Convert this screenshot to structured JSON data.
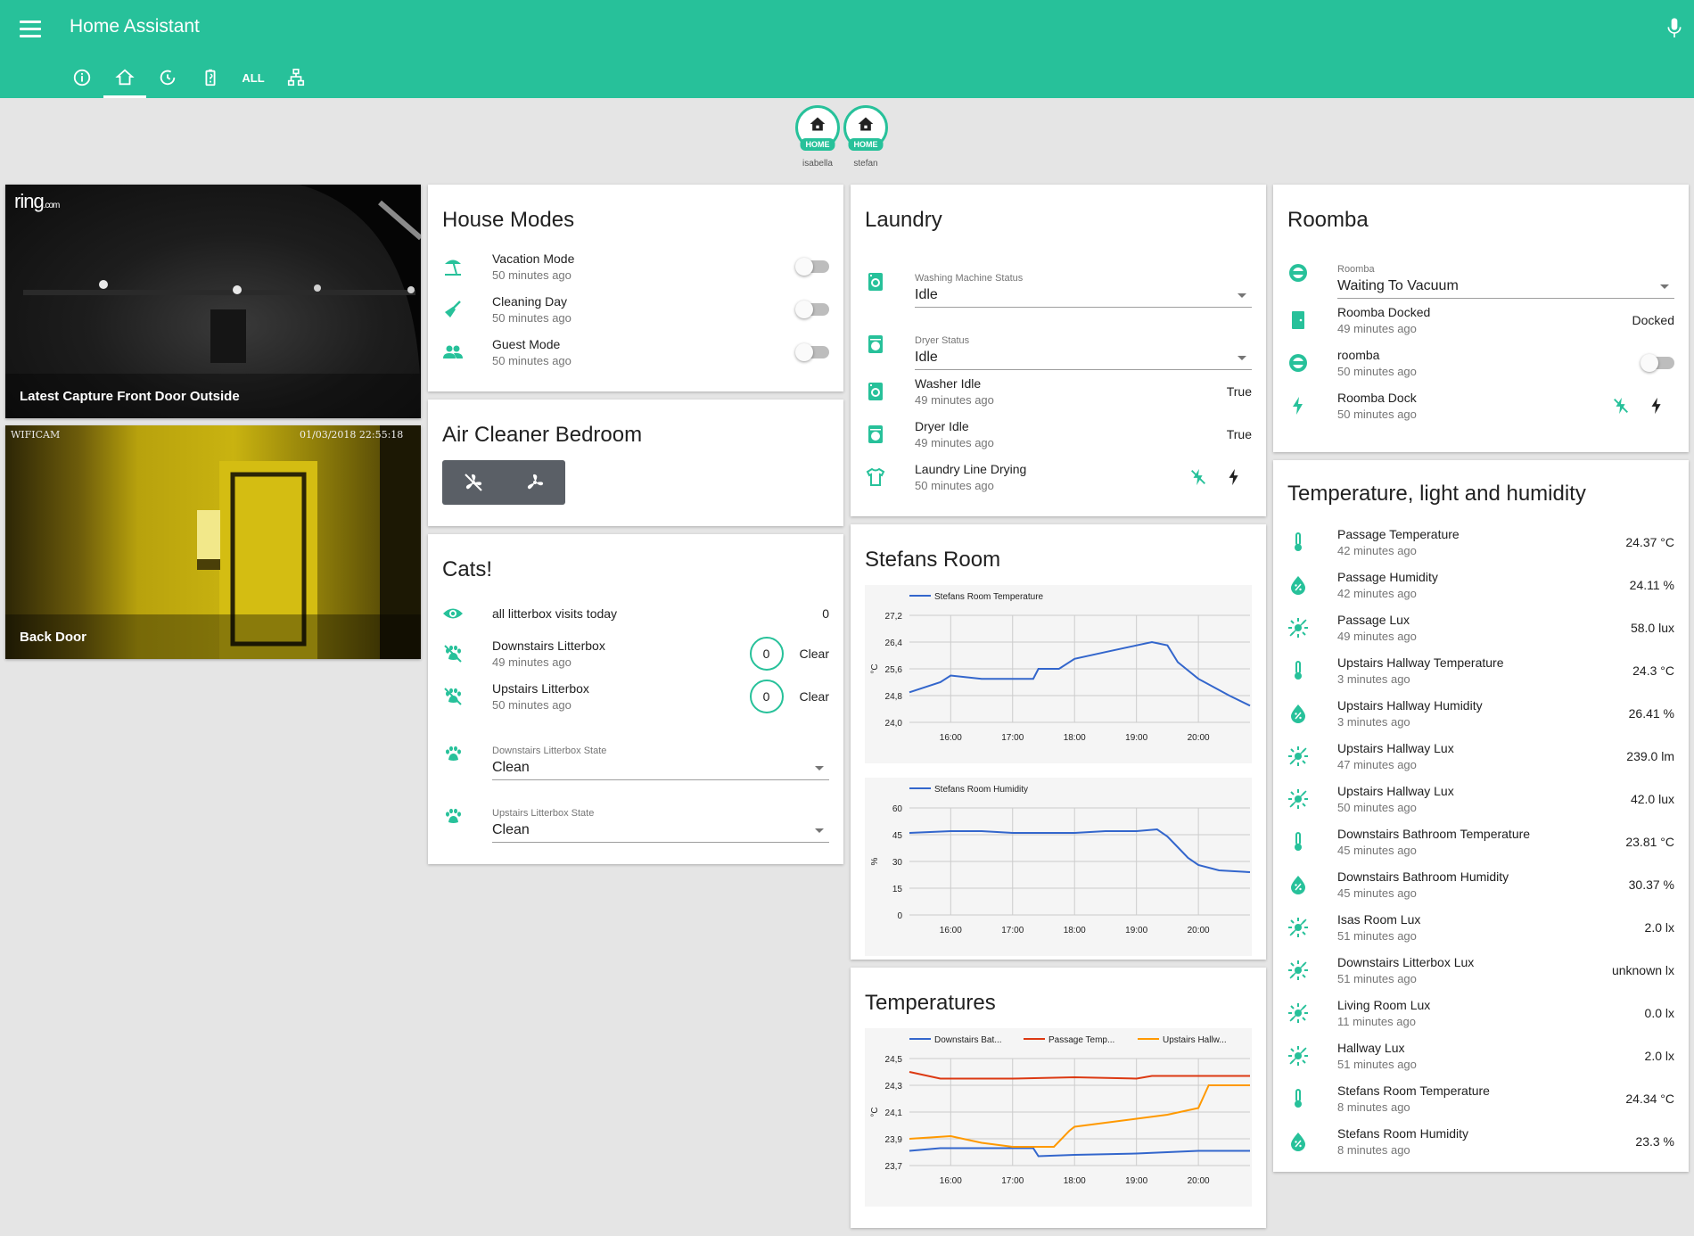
{
  "header": {
    "title": "Home Assistant",
    "tabs": [
      {
        "icon": "info-icon"
      },
      {
        "icon": "home-icon",
        "active": true
      },
      {
        "icon": "history-icon"
      },
      {
        "icon": "battery-icon"
      },
      {
        "label": "ALL"
      },
      {
        "icon": "network-icon"
      }
    ]
  },
  "badges": [
    {
      "tag": "HOME",
      "name": "isabella"
    },
    {
      "tag": "HOME",
      "name": "stefan"
    }
  ],
  "cameras": [
    {
      "caption": "Latest Capture Front Door Outside",
      "logo": "ring",
      "logo_suffix": ".com"
    },
    {
      "caption": "Back Door",
      "overlay_left": "WIFICAM",
      "overlay_time": "01/03/2018 22:55:18"
    }
  ],
  "house_modes": {
    "title": "House Modes",
    "items": [
      {
        "name": "Vacation Mode",
        "sub": "50 minutes ago",
        "icon": "beach-icon",
        "on": false
      },
      {
        "name": "Cleaning Day",
        "sub": "50 minutes ago",
        "icon": "broom-icon",
        "on": false
      },
      {
        "name": "Guest Mode",
        "sub": "50 minutes ago",
        "icon": "people-icon",
        "on": false
      }
    ]
  },
  "air_cleaner": {
    "title": "Air Cleaner Bedroom"
  },
  "cats": {
    "title": "Cats!",
    "visits": {
      "name": "all litterbox visits today",
      "value": "0"
    },
    "litterboxes": [
      {
        "name": "Downstairs Litterbox",
        "sub": "49 minutes ago",
        "count": "0",
        "clear": "Clear"
      },
      {
        "name": "Upstairs Litterbox",
        "sub": "50 minutes ago",
        "count": "0",
        "clear": "Clear"
      }
    ],
    "states": [
      {
        "label": "Downstairs Litterbox State",
        "value": "Clean"
      },
      {
        "label": "Upstairs Litterbox State",
        "value": "Clean"
      }
    ]
  },
  "laundry": {
    "title": "Laundry",
    "selects": [
      {
        "label": "Washing Machine Status",
        "value": "Idle"
      },
      {
        "label": "Dryer Status",
        "value": "Idle"
      }
    ],
    "items": [
      {
        "name": "Washer Idle",
        "sub": "49 minutes ago",
        "state": "True"
      },
      {
        "name": "Dryer Idle",
        "sub": "49 minutes ago",
        "state": "True"
      }
    ],
    "line": {
      "name": "Laundry Line Drying",
      "sub": "50 minutes ago"
    }
  },
  "stefans_room": {
    "title": "Stefans Room"
  },
  "temperatures": {
    "title": "Temperatures"
  },
  "chart_data": [
    {
      "type": "line",
      "title": "",
      "series": [
        {
          "name": "Stefans Room Temperature",
          "color": "#3366cc",
          "x": [
            "15:20",
            "15:50",
            "16:00",
            "16:30",
            "17:00",
            "17:20",
            "17:25",
            "17:45",
            "18:00",
            "18:30",
            "19:00",
            "19:15",
            "19:30",
            "19:40",
            "20:00",
            "20:30",
            "20:50"
          ],
          "values": [
            24.9,
            25.2,
            25.4,
            25.3,
            25.3,
            25.3,
            25.6,
            25.6,
            25.9,
            26.1,
            26.3,
            26.4,
            26.3,
            25.8,
            25.3,
            24.8,
            24.5
          ]
        }
      ],
      "ylabel": "°C",
      "yticks": [
        "24,0",
        "24,8",
        "25,6",
        "26,4",
        "27,2"
      ],
      "ylim": [
        24.0,
        27.2
      ],
      "xticks": [
        "16:00",
        "17:00",
        "18:00",
        "19:00",
        "20:00"
      ]
    },
    {
      "type": "line",
      "title": "",
      "series": [
        {
          "name": "Stefans Room Humidity",
          "color": "#3366cc",
          "x": [
            "15:20",
            "16:00",
            "16:30",
            "17:00",
            "17:30",
            "18:00",
            "18:30",
            "19:00",
            "19:20",
            "19:30",
            "19:40",
            "19:50",
            "20:00",
            "20:20",
            "20:50"
          ],
          "values": [
            46,
            47,
            47,
            46,
            46,
            46,
            47,
            47,
            48,
            44,
            38,
            32,
            28,
            25,
            24
          ]
        }
      ],
      "ylabel": "%",
      "yticks": [
        "0",
        "15",
        "30",
        "45",
        "60"
      ],
      "ylim": [
        0,
        60
      ],
      "xticks": [
        "16:00",
        "17:00",
        "18:00",
        "19:00",
        "20:00"
      ]
    },
    {
      "type": "line",
      "title": "",
      "series": [
        {
          "name": "Downstairs Bat...",
          "color": "#3366cc",
          "x": [
            "15:20",
            "15:50",
            "16:00",
            "17:00",
            "17:20",
            "17:25",
            "18:00",
            "19:00",
            "20:00",
            "20:50"
          ],
          "values": [
            23.81,
            23.83,
            23.83,
            23.83,
            23.83,
            23.77,
            23.78,
            23.79,
            23.81,
            23.81
          ]
        },
        {
          "name": "Passage Temp...",
          "color": "#dc3912",
          "x": [
            "15:20",
            "15:50",
            "16:00",
            "17:00",
            "18:00",
            "19:00",
            "19:15",
            "20:00",
            "20:50"
          ],
          "values": [
            24.4,
            24.35,
            24.35,
            24.35,
            24.36,
            24.35,
            24.37,
            24.37,
            24.37
          ]
        },
        {
          "name": "Upstairs Hallw...",
          "color": "#ff9900",
          "x": [
            "15:20",
            "16:00",
            "16:30",
            "17:00",
            "17:40",
            "17:55",
            "18:00",
            "18:30",
            "19:00",
            "19:30",
            "20:00",
            "20:10",
            "20:50"
          ],
          "values": [
            23.9,
            23.92,
            23.87,
            23.84,
            23.84,
            23.96,
            23.99,
            24.02,
            24.05,
            24.08,
            24.13,
            24.3,
            24.3
          ]
        }
      ],
      "ylabel": "°C",
      "yticks": [
        "23,7",
        "23,9",
        "24,1",
        "24,3",
        "24,5"
      ],
      "ylim": [
        23.7,
        24.5
      ],
      "xticks": [
        "16:00",
        "17:00",
        "18:00",
        "19:00",
        "20:00"
      ]
    }
  ],
  "roomba": {
    "title": "Roomba",
    "select": {
      "label": "Roomba",
      "value": "Waiting To Vacuum"
    },
    "items": [
      {
        "name": "Roomba Docked",
        "sub": "49 minutes ago",
        "state": "Docked"
      },
      {
        "name": "roomba",
        "sub": "50 minutes ago",
        "on": false
      },
      {
        "name": "Roomba Dock",
        "sub": "50 minutes ago"
      }
    ]
  },
  "sensors": {
    "title": "Temperature, light and humidity",
    "items": [
      {
        "name": "Passage Temperature",
        "sub": "42 minutes ago",
        "state": "24.37 °C",
        "icon": "thermometer-icon"
      },
      {
        "name": "Passage Humidity",
        "sub": "42 minutes ago",
        "state": "24.11 %",
        "icon": "water-percent-icon"
      },
      {
        "name": "Passage Lux",
        "sub": "49 minutes ago",
        "state": "58.0 lux",
        "icon": "brightness-icon"
      },
      {
        "name": "Upstairs Hallway Temperature",
        "sub": "3 minutes ago",
        "state": "24.3 °C",
        "icon": "thermometer-icon"
      },
      {
        "name": "Upstairs Hallway Humidity",
        "sub": "3 minutes ago",
        "state": "26.41 %",
        "icon": "water-percent-icon"
      },
      {
        "name": "Upstairs Hallway Lux",
        "sub": "47 minutes ago",
        "state": "239.0 lm",
        "icon": "brightness-icon"
      },
      {
        "name": "Upstairs Hallway Lux",
        "sub": "50 minutes ago",
        "state": "42.0 lux",
        "icon": "brightness-icon"
      },
      {
        "name": "Downstairs Bathroom Temperature",
        "sub": "45 minutes ago",
        "state": "23.81 °C",
        "icon": "thermometer-icon"
      },
      {
        "name": "Downstairs Bathroom Humidity",
        "sub": "45 minutes ago",
        "state": "30.37 %",
        "icon": "water-percent-icon"
      },
      {
        "name": "Isas Room Lux",
        "sub": "51 minutes ago",
        "state": "2.0 lx",
        "icon": "brightness-icon"
      },
      {
        "name": "Downstairs Litterbox Lux",
        "sub": "51 minutes ago",
        "state": "unknown lx",
        "icon": "brightness-icon"
      },
      {
        "name": "Living Room Lux",
        "sub": "11 minutes ago",
        "state": "0.0 lx",
        "icon": "brightness-icon"
      },
      {
        "name": "Hallway Lux",
        "sub": "51 minutes ago",
        "state": "2.0 lx",
        "icon": "brightness-icon"
      },
      {
        "name": "Stefans Room Temperature",
        "sub": "8 minutes ago",
        "state": "24.34 °C",
        "icon": "thermometer-icon"
      },
      {
        "name": "Stefans Room Humidity",
        "sub": "8 minutes ago",
        "state": "23.3 %",
        "icon": "water-percent-icon"
      }
    ]
  },
  "colors": {
    "accent": "#27c19a",
    "icon": "#44739e"
  }
}
